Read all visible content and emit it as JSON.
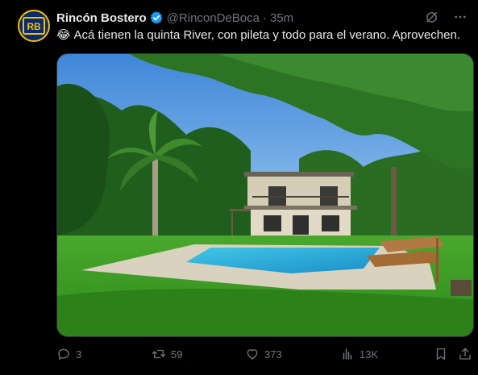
{
  "tweet": {
    "author": {
      "display_name": "Rincón Bostero",
      "handle": "@RinconDeBoca",
      "avatar_initials": "RB",
      "verified": true
    },
    "separator": "·",
    "time": "35m",
    "emoji": "😂",
    "text": "Acá tienen la quinta River, con pileta y todo para el verano. Aprovechen.",
    "actions": {
      "replies": "3",
      "retweets": "59",
      "likes": "373",
      "views": "13K"
    }
  },
  "colors": {
    "background": "#000000",
    "text": "#e7e9ea",
    "muted": "#71767b",
    "verified": "#1d9bf0",
    "avatar_bg": "#0b2a6b",
    "avatar_gold": "#f2c200"
  },
  "icons": {
    "header": [
      "grok-icon",
      "more-icon"
    ],
    "actions": [
      "reply-icon",
      "retweet-icon",
      "like-icon",
      "views-icon",
      "bookmark-icon",
      "share-icon"
    ]
  }
}
